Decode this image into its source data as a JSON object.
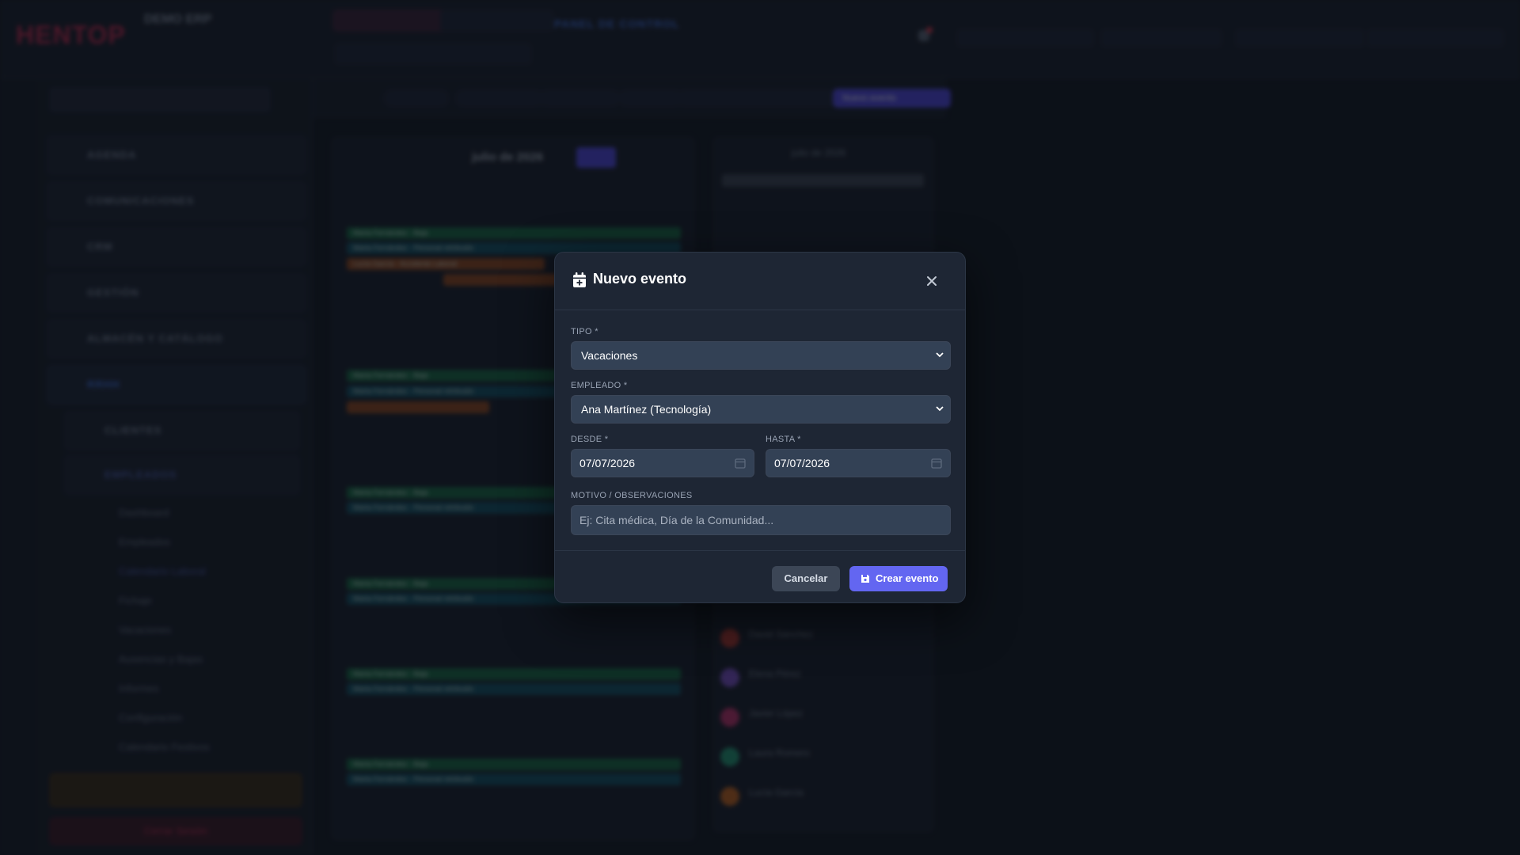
{
  "background": {
    "logo": "HENTOP",
    "company_name": "DEMO ERP",
    "panel_title": "PANEL DE CONTROL",
    "sidebar_items": [
      "AGENDA",
      "COMUNICACIONES",
      "CRM",
      "GESTIÓN",
      "ALMACÉN Y CATÁLOGO",
      "RRHH",
      "CLIENTES",
      "EMPLEADOS"
    ],
    "sidebar_subitems": [
      "Dashboard",
      "Empleados",
      "Calendario Laboral",
      "Fichaje",
      "Vacaciones",
      "Ausencias y Bajas",
      "Informes",
      "Configuración",
      "Calendario Festivos"
    ],
    "logout_label": "Cerrar Sesión",
    "calendar_month": "julio de 2026",
    "mini_calendar_month": "julio de 2026",
    "events": [
      "Marta Fernández - Baja",
      "Marta Fernández - Personal retribuido",
      "Lucía García - Accidente Laboral"
    ],
    "employees": [
      "David Sánchez",
      "Elena Pérez",
      "Javier López",
      "Laura Romero",
      "Lucía García"
    ],
    "new_event_chip": "Nuevo evento"
  },
  "modal": {
    "title": "Nuevo evento",
    "tipo_label": "TIPO *",
    "tipo_value": "Vacaciones",
    "empleado_label": "EMPLEADO *",
    "empleado_value": "Ana Martínez (Tecnología)",
    "desde_label": "DESDE *",
    "desde_value": "07/07/2026",
    "hasta_label": "HASTA *",
    "hasta_value": "07/07/2026",
    "motivo_label": "MOTIVO / OBSERVACIONES",
    "motivo_placeholder": "Ej: Cita médica, Día de la Comunidad...",
    "cancel_label": "Cancelar",
    "create_label": "Crear evento"
  },
  "colors": {
    "accent": "#6366f1",
    "modal_bg": "#1e2634",
    "field_bg": "#334155"
  }
}
